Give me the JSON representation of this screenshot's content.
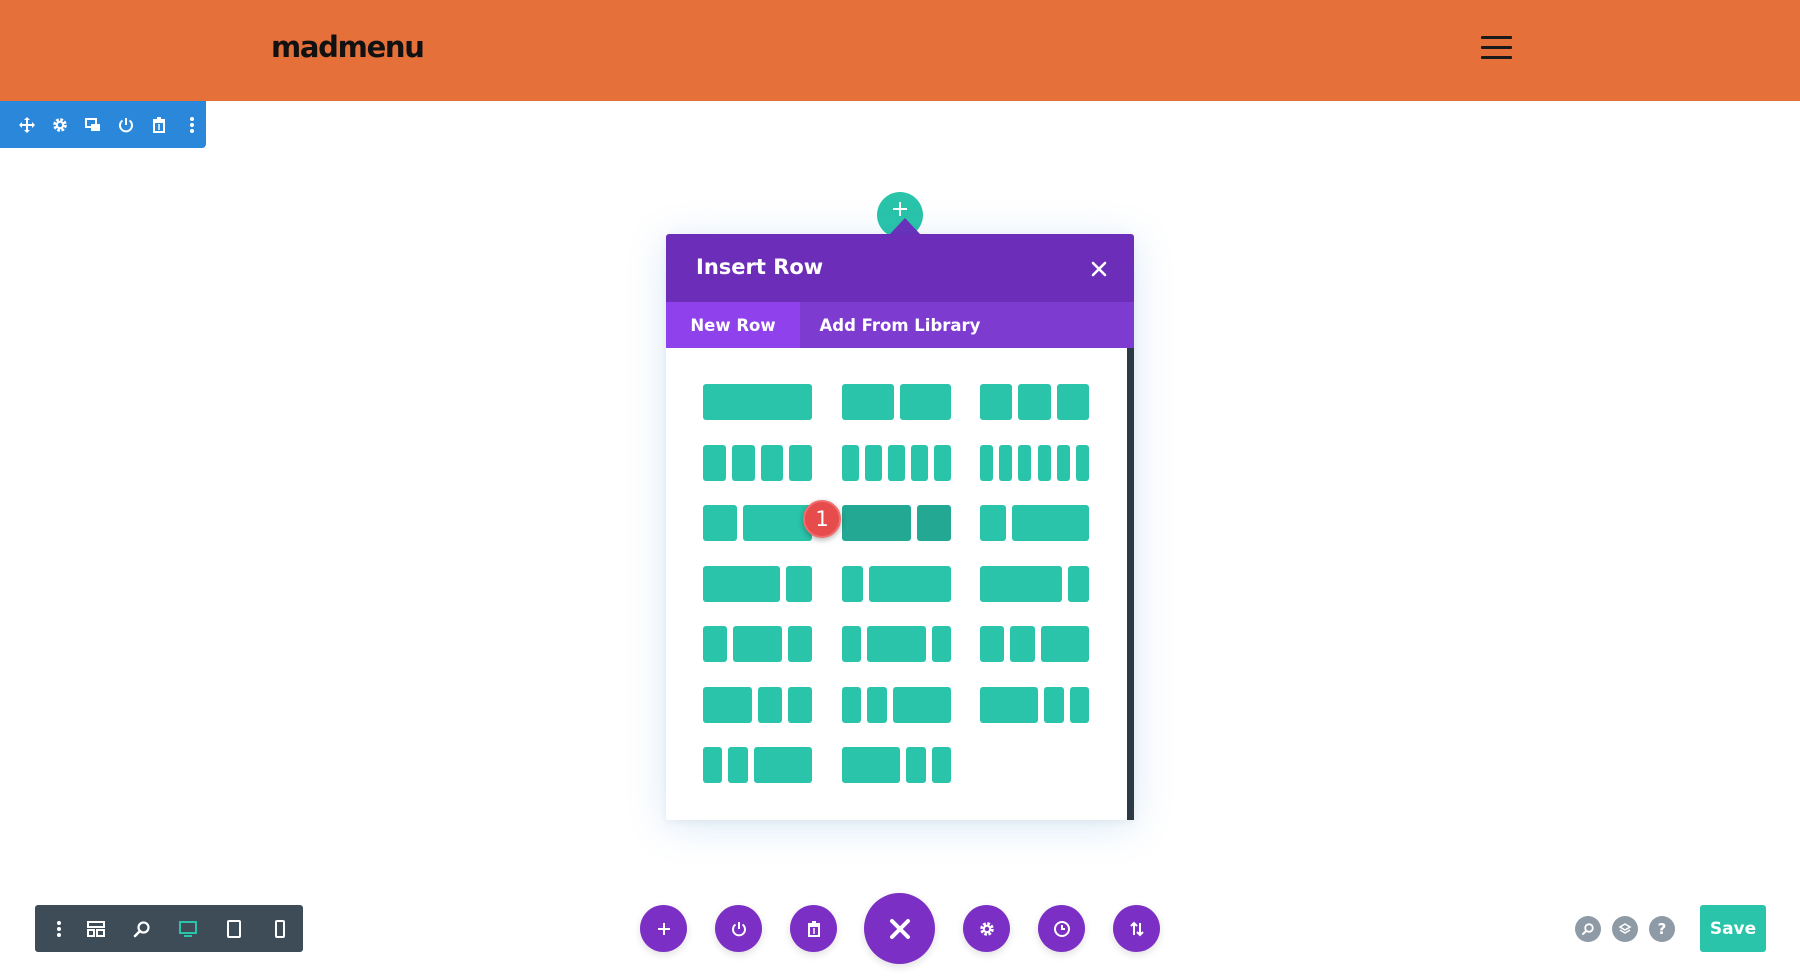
{
  "header": {
    "logo_text": "madmenu",
    "menu_icon": "hamburger-icon",
    "background": "#e5703a"
  },
  "section_toolbar": {
    "background": "#2b87da",
    "icons": [
      "move-icon",
      "gear-icon",
      "duplicate-icon",
      "power-icon",
      "trash-icon",
      "more-vertical-icon"
    ]
  },
  "insert_row_modal": {
    "title": "Insert Row",
    "close_icon": "close-icon",
    "tabs": [
      {
        "label": "New Row",
        "active": true
      },
      {
        "label": "Add From Library",
        "active": false
      }
    ],
    "header_color": "#6c2eb9",
    "tab_bar_color": "#7e3bd0",
    "active_tab_color": "#8f42ec",
    "column_color": "#29c4a9",
    "layouts": [
      {
        "name": "1 column",
        "columns": [
          1
        ]
      },
      {
        "name": "2 equal columns",
        "columns": [
          1,
          1
        ]
      },
      {
        "name": "3 equal columns",
        "columns": [
          1,
          1,
          1
        ]
      },
      {
        "name": "4 equal columns",
        "columns": [
          1,
          1,
          1,
          1
        ]
      },
      {
        "name": "5 equal columns",
        "columns": [
          1,
          1,
          1,
          1,
          1
        ]
      },
      {
        "name": "6 equal columns",
        "columns": [
          1,
          1,
          1,
          1,
          1,
          1
        ]
      },
      {
        "name": "1/3 + 2/3",
        "columns": [
          1,
          2
        ]
      },
      {
        "name": "2/3 + 1/3",
        "columns": [
          2,
          1
        ],
        "highlighted": true
      },
      {
        "name": "1/4 + 3/4",
        "columns": [
          1,
          3
        ]
      },
      {
        "name": "3/4 + 1/4",
        "columns": [
          3,
          1
        ]
      },
      {
        "name": "1/5 + 4/5",
        "columns": [
          1,
          4
        ]
      },
      {
        "name": "4/5 + 1/5",
        "columns": [
          4,
          1
        ]
      },
      {
        "name": "1/4 + 1/2 + 1/4",
        "columns": [
          1,
          2,
          1
        ]
      },
      {
        "name": "1/5 + 3/5 + 1/5",
        "columns": [
          1,
          3,
          1
        ]
      },
      {
        "name": "1/4 + 1/4 + 1/2",
        "columns": [
          1,
          1,
          2
        ]
      },
      {
        "name": "1/2 + 1/4 + 1/4",
        "columns": [
          2,
          1,
          1
        ]
      },
      {
        "name": "1/5 + 1/5 + 3/5",
        "columns": [
          1,
          1,
          3
        ]
      },
      {
        "name": "3/5 + 1/5 + 1/5",
        "columns": [
          3,
          1,
          1
        ]
      },
      {
        "name": "1/6 + 1/6 + 1/2",
        "columns": [
          1,
          1,
          3
        ]
      },
      {
        "name": "1/2 + 1/6 + 1/6",
        "columns": [
          3,
          1,
          1
        ]
      }
    ],
    "annotation_badge": "1"
  },
  "bottom_left_bar": {
    "icons": [
      "more-vertical-icon",
      "wireframe-icon",
      "zoom-icon",
      "desktop-icon",
      "tablet-icon",
      "phone-icon"
    ],
    "active_icon": "desktop-icon",
    "active_color": "#29c4a9"
  },
  "bottom_center_controls": {
    "buttons": [
      "add-icon",
      "power-icon",
      "trash-icon",
      "close-icon",
      "gear-icon",
      "history-icon",
      "sort-icon"
    ],
    "color": "#7b2fc4"
  },
  "bottom_right": {
    "icons": [
      "search-icon",
      "layers-icon",
      "help-icon"
    ],
    "help_glyph": "?",
    "save_label": "Save",
    "save_color": "#29c4a9"
  }
}
